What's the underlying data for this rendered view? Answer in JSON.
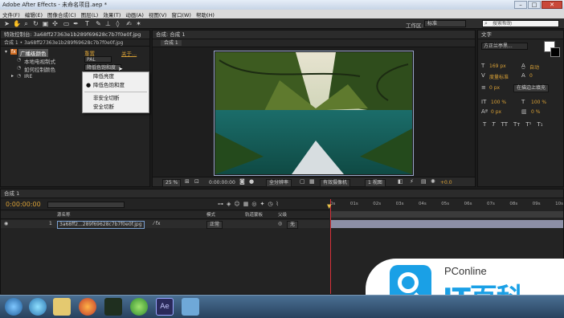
{
  "window": {
    "title": "Adobe After Effects - 未命名项目.aep *",
    "min": "–",
    "max": "□",
    "close": "✕"
  },
  "menu": [
    "文件(F)",
    "编辑(E)",
    "图像合成(C)",
    "图层(L)",
    "效果(T)",
    "动画(A)",
    "视图(V)",
    "窗口(W)",
    "帮助(H)"
  ],
  "toolbar": {
    "workspace_label": "工作区:",
    "workspace_value": "标准",
    "search_placeholder": "搜索帮助"
  },
  "effects_panel": {
    "tab": "特效控制台: 3a68ff27363e1b289f69628c7b7f0e0f.jpg",
    "path": "合成 1 • 3a68ff27363e1b289f69628c7b7f0e0f.jpg",
    "effect_name": "广播级颜色",
    "reset": "重置",
    "about": "关于...",
    "prop1_label": "本地电视制式",
    "prop1_value": "PAL",
    "prop2_label": "如何控制颜色",
    "prop2_value": "降低色饱和度",
    "prop3_label": "IRE",
    "context_menu": {
      "items": [
        "降低亮度",
        "降低色饱和度",
        "非安全切断",
        "安全切断"
      ],
      "checked_index": 1
    }
  },
  "comp_panel": {
    "tab": "合成: 合成 1",
    "subtab": "合成 1",
    "zoom": "25 %",
    "timecode": "0:00:00:00",
    "resolution": "全分辨率",
    "camera": "有效摄像机",
    "views": "1 视图",
    "exposure": "+0.0"
  },
  "character_panel": {
    "tab": "文字",
    "font": "方正兰亭黑...",
    "font_size": "169 px",
    "leading": "自动",
    "kerning": "度量标准",
    "tracking": "0",
    "stroke": "0 px",
    "stroke_mode": "在描边上填充",
    "vscale": "100 %",
    "hscale": "100 %",
    "baseline": "0 px",
    "tsume": "0 %",
    "styles": [
      "T",
      "T",
      "TT",
      "Tт",
      "T¹",
      "T₁"
    ]
  },
  "timeline": {
    "tab": "合成 1",
    "timecode": "0:00:00:00",
    "columns": {
      "source": "源名称",
      "mode": "模式",
      "trkmat": "轨道蒙板",
      "parent": "父级"
    },
    "layer": {
      "num": "1",
      "name": "3a68ff2...289f69628c7b7f0e0f.jpg",
      "mode": "正常",
      "parent": "无"
    },
    "ruler_labels": [
      "0s",
      "01s",
      "02s",
      "03s",
      "04s",
      "05s",
      "06s",
      "07s",
      "08s",
      "09s",
      "10s"
    ]
  },
  "watermark": {
    "brand": "PConline",
    "text": "IT百科"
  }
}
